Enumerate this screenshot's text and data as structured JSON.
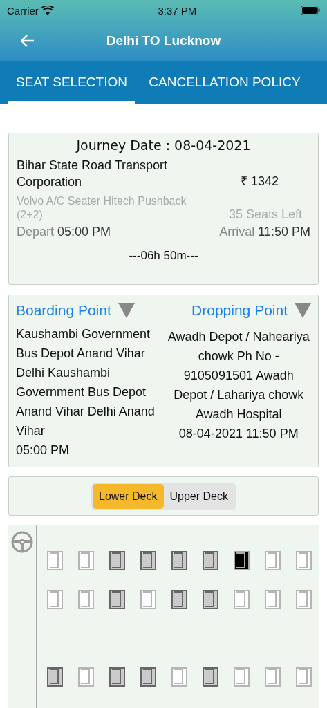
{
  "status_bar": {
    "carrier": "Carrier",
    "time": "3:37 PM"
  },
  "header": {
    "title": "Delhi TO Lucknow"
  },
  "tabs": [
    {
      "label": "SEAT SELECTION",
      "selected": true
    },
    {
      "label": "CANCELLATION POLICY",
      "selected": false
    }
  ],
  "journey": {
    "date_label": "Journey Date : 08-04-2021",
    "operator": "Bihar State Road Transport Corporation",
    "fare": "₹ 1342",
    "bus_type": "Volvo A/C Seater Hitech Pushback (2+2)",
    "seats_left": "35 Seats Left",
    "depart_label": "Depart",
    "depart_time": "05:00 PM",
    "arrival_label": "Arrival",
    "arrival_time": "11:50 PM",
    "duration": "---06h 50m---"
  },
  "points": {
    "boarding_title": "Boarding Point",
    "boarding_text": "Kaushambi Government Bus Depot Anand Vihar Delhi Kaushambi Government Bus Depot Anand Vihar Delhi Anand Vihar",
    "boarding_time": "05:00 PM",
    "dropping_title": "Dropping Point",
    "dropping_text": "Awadh Depot / Naheariya chowk Ph No - 9105091501 Awadh Depot / Lahariya chowk Awadh Hospital",
    "dropping_time": "08-04-2021 11:50 PM"
  },
  "decks": [
    {
      "label": "Lower Deck",
      "selected": true
    },
    {
      "label": "Upper Deck",
      "selected": false
    }
  ],
  "seat_rows": [
    {
      "seats": [
        {
          "booked": false,
          "selected": false
        },
        {
          "booked": false,
          "selected": false
        },
        {
          "booked": true,
          "selected": false
        },
        {
          "booked": true,
          "selected": false
        },
        {
          "booked": true,
          "selected": false
        },
        {
          "booked": true,
          "selected": false
        },
        {
          "booked": false,
          "selected": true
        },
        {
          "booked": false,
          "selected": false
        },
        {
          "booked": false,
          "selected": false
        }
      ]
    },
    {
      "seats": [
        {
          "booked": false,
          "selected": false
        },
        {
          "booked": false,
          "selected": false
        },
        {
          "booked": true,
          "selected": false
        },
        {
          "booked": false,
          "selected": false
        },
        {
          "booked": true,
          "selected": false
        },
        {
          "booked": true,
          "selected": false
        },
        {
          "booked": false,
          "selected": false
        },
        {
          "booked": false,
          "selected": false
        },
        {
          "booked": false,
          "selected": false
        }
      ]
    },
    {
      "seats": [
        {
          "booked": true,
          "selected": false
        },
        {
          "booked": false,
          "selected": false
        },
        {
          "booked": true,
          "selected": false
        },
        {
          "booked": true,
          "selected": false
        },
        {
          "booked": false,
          "selected": false
        },
        {
          "booked": true,
          "selected": false
        },
        {
          "booked": false,
          "selected": false
        },
        {
          "booked": false,
          "selected": false
        },
        {
          "booked": false,
          "selected": false
        }
      ]
    }
  ]
}
